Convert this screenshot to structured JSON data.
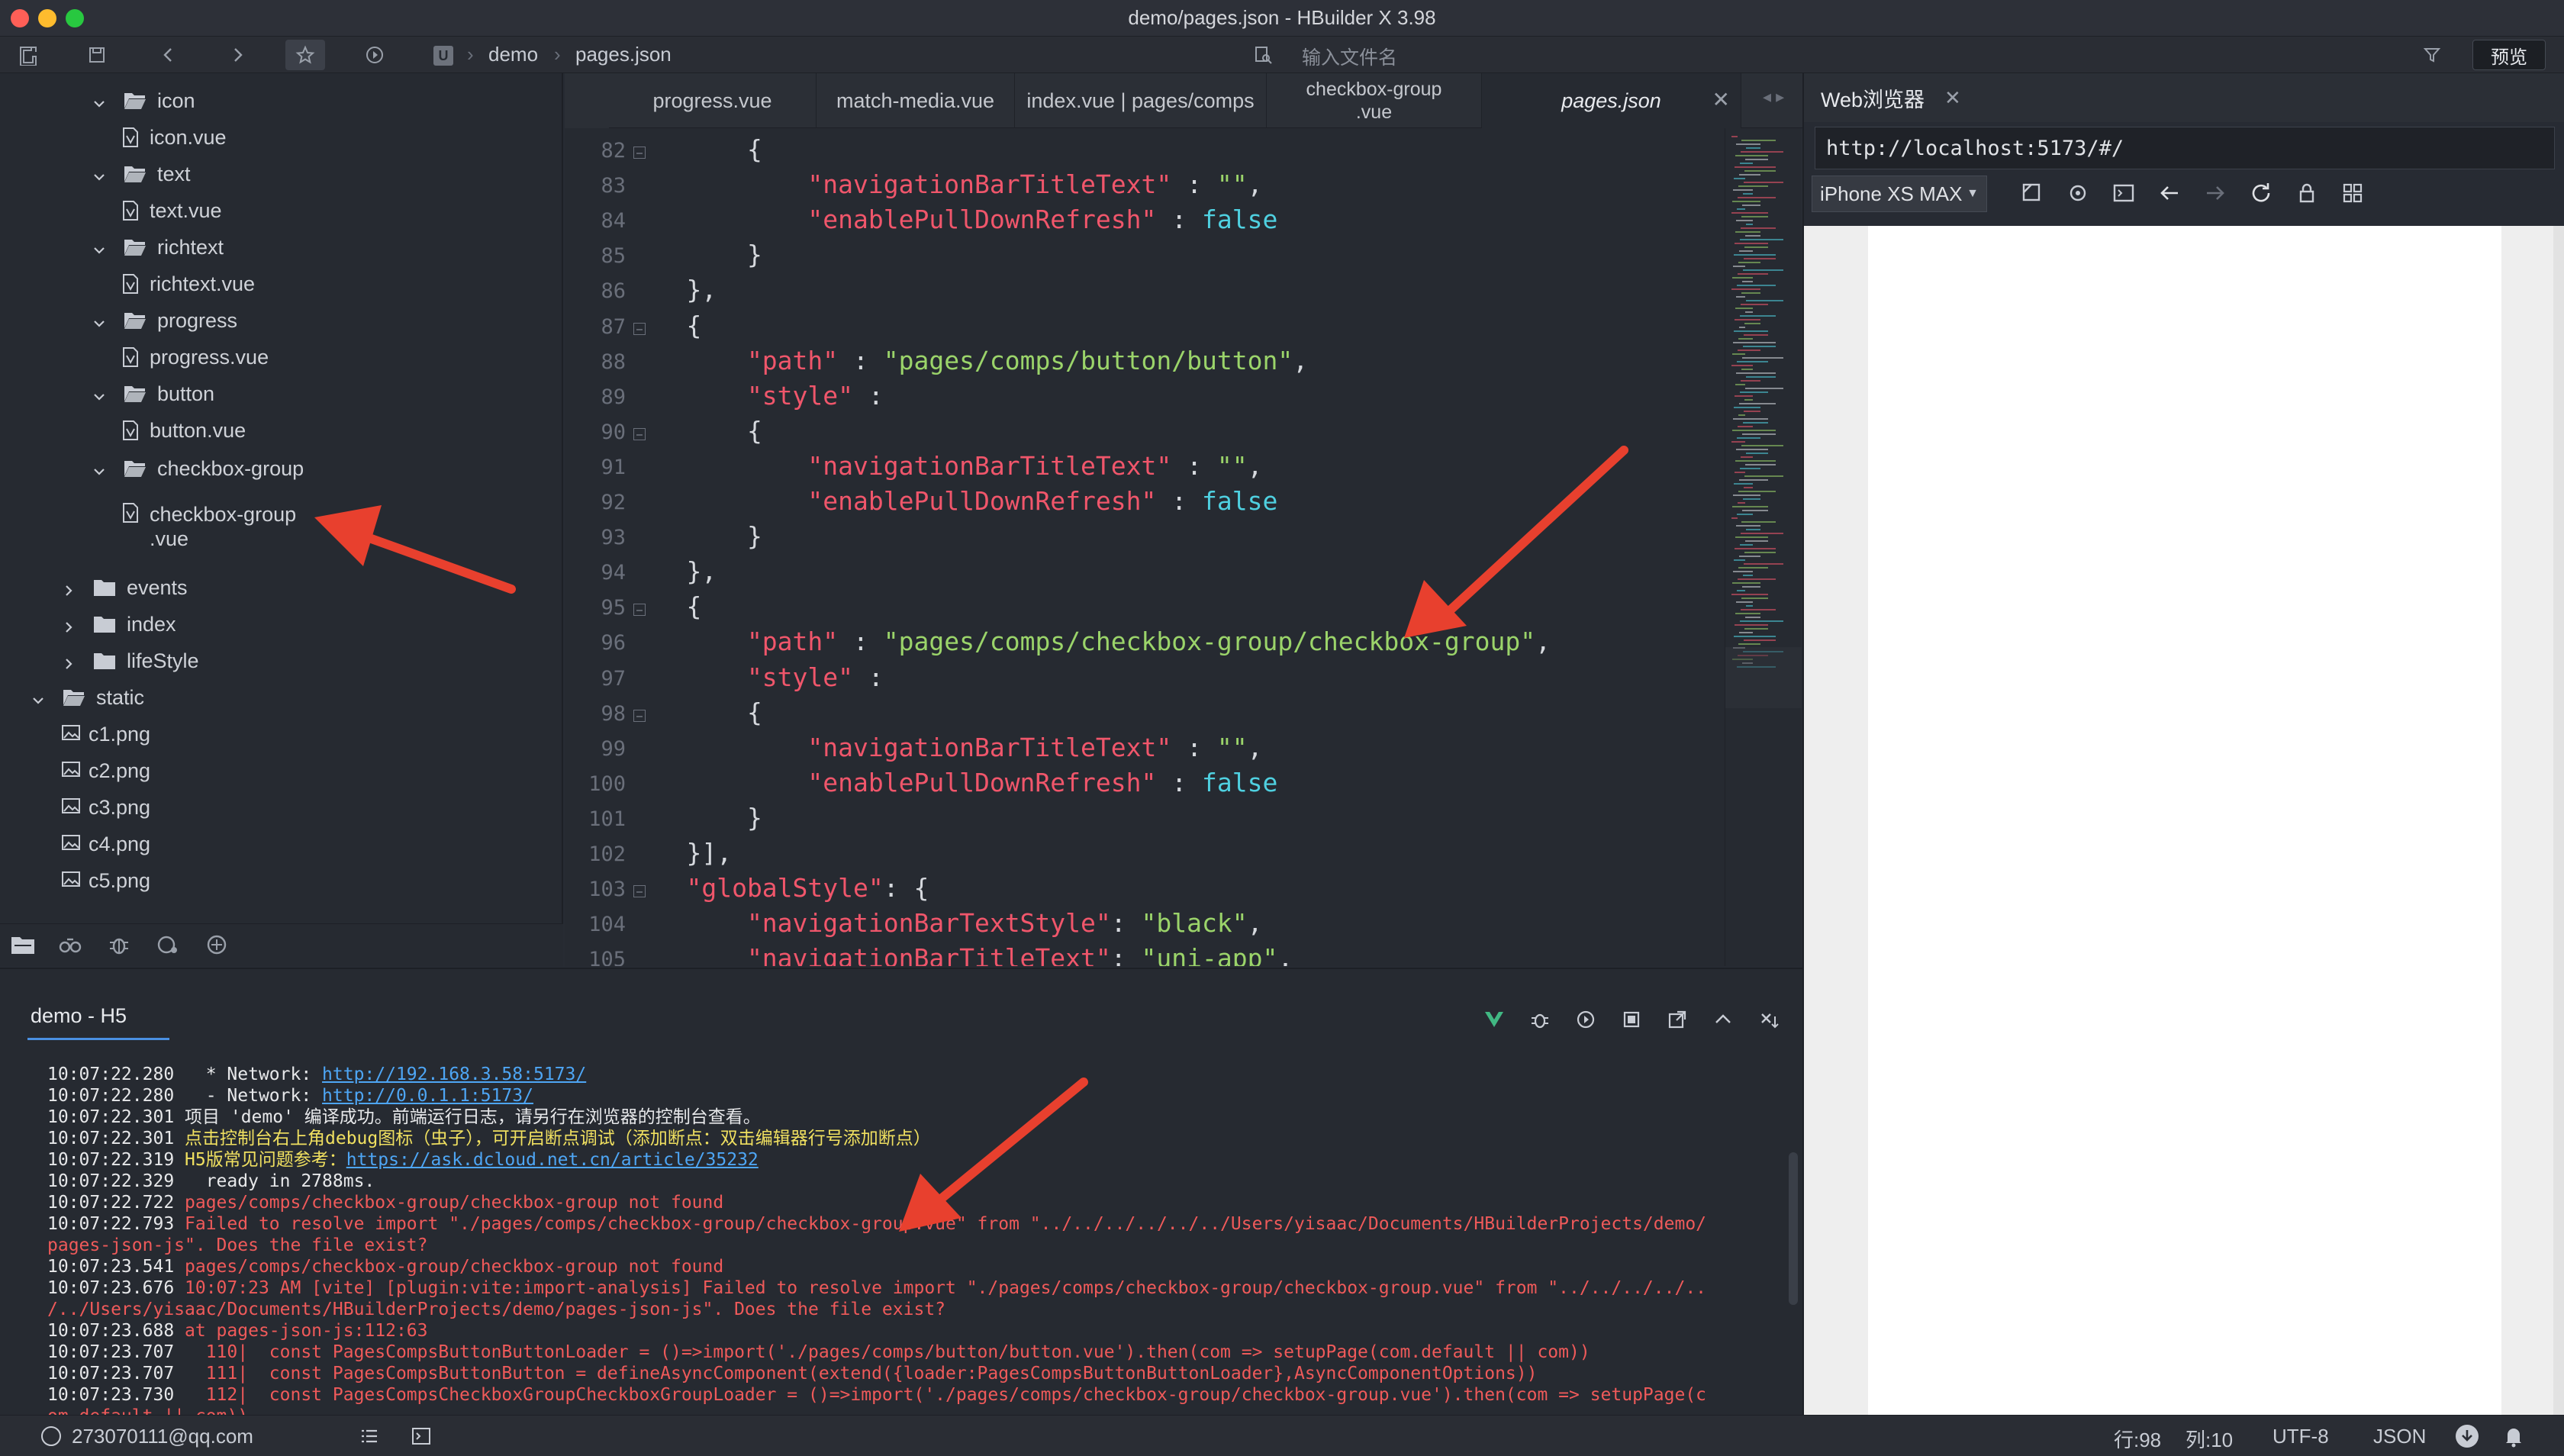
{
  "window": {
    "title": "demo/pages.json - HBuilder X 3.98"
  },
  "toolbar": {
    "breadcrumb": [
      "demo",
      "pages.json"
    ],
    "file_search_placeholder": "输入文件名",
    "preview_label": "预览"
  },
  "explorer": {
    "items": [
      {
        "label": "icon",
        "type": "folder",
        "expanded": true
      },
      {
        "label": "icon.vue",
        "type": "file"
      },
      {
        "label": "text",
        "type": "folder",
        "expanded": true
      },
      {
        "label": "text.vue",
        "type": "file"
      },
      {
        "label": "richtext",
        "type": "folder",
        "expanded": true
      },
      {
        "label": "richtext.vue",
        "type": "file"
      },
      {
        "label": "progress",
        "type": "folder",
        "expanded": true
      },
      {
        "label": "progress.vue",
        "type": "file"
      },
      {
        "label": "button",
        "type": "folder",
        "expanded": true
      },
      {
        "label": "button.vue",
        "type": "file"
      },
      {
        "label": "checkbox-group",
        "type": "folder",
        "expanded": true
      },
      {
        "label": "checkbox-group",
        "label2": ".vue",
        "type": "file"
      },
      {
        "label": "events",
        "type": "folder",
        "expanded": false
      },
      {
        "label": "index",
        "type": "folder",
        "expanded": false
      },
      {
        "label": "lifeStyle",
        "type": "folder",
        "expanded": false
      },
      {
        "label": "static",
        "type": "folder",
        "expanded": true
      },
      {
        "label": "c1.png",
        "type": "image"
      },
      {
        "label": "c2.png",
        "type": "image"
      },
      {
        "label": "c3.png",
        "type": "image"
      },
      {
        "label": "c4.png",
        "type": "image"
      },
      {
        "label": "c5.png",
        "type": "image"
      }
    ]
  },
  "tabs": [
    {
      "label": "progress.vue",
      "active": false
    },
    {
      "label": "match-media.vue",
      "active": false
    },
    {
      "label": "index.vue | pages/comps",
      "active": false
    },
    {
      "label": "checkbox-group\n.vue",
      "active": false
    },
    {
      "label": "pages.json",
      "active": true
    }
  ],
  "editor": {
    "lines": [
      {
        "n": "82",
        "fold": true,
        "parts": [
          [
            "p",
            "        {"
          ]
        ]
      },
      {
        "n": "83",
        "fold": false,
        "parts": [
          [
            "k",
            "            \"navigationBarTitleText\""
          ],
          [
            "p",
            " : "
          ],
          [
            "s",
            "\"\""
          ],
          [
            "p",
            ","
          ]
        ]
      },
      {
        "n": "84",
        "fold": false,
        "parts": [
          [
            "k",
            "            \"enablePullDownRefresh\""
          ],
          [
            "p",
            " : "
          ],
          [
            "b",
            "false"
          ]
        ]
      },
      {
        "n": "85",
        "fold": false,
        "parts": [
          [
            "p",
            "        }"
          ]
        ]
      },
      {
        "n": "86",
        "fold": false,
        "parts": [
          [
            "p",
            "    },"
          ]
        ]
      },
      {
        "n": "87",
        "fold": true,
        "parts": [
          [
            "p",
            "    {"
          ]
        ]
      },
      {
        "n": "88",
        "fold": false,
        "parts": [
          [
            "k",
            "        \"path\""
          ],
          [
            "p",
            " : "
          ],
          [
            "s",
            "\"pages/comps/button/button\""
          ],
          [
            "p",
            ","
          ]
        ]
      },
      {
        "n": "89",
        "fold": false,
        "parts": [
          [
            "k",
            "        \"style\""
          ],
          [
            "p",
            " :"
          ]
        ]
      },
      {
        "n": "90",
        "fold": true,
        "parts": [
          [
            "p",
            "        {"
          ]
        ]
      },
      {
        "n": "91",
        "fold": false,
        "parts": [
          [
            "k",
            "            \"navigationBarTitleText\""
          ],
          [
            "p",
            " : "
          ],
          [
            "s",
            "\"\""
          ],
          [
            "p",
            ","
          ]
        ]
      },
      {
        "n": "92",
        "fold": false,
        "parts": [
          [
            "k",
            "            \"enablePullDownRefresh\""
          ],
          [
            "p",
            " : "
          ],
          [
            "b",
            "false"
          ]
        ]
      },
      {
        "n": "93",
        "fold": false,
        "parts": [
          [
            "p",
            "        }"
          ]
        ]
      },
      {
        "n": "94",
        "fold": false,
        "parts": [
          [
            "p",
            "    },"
          ]
        ]
      },
      {
        "n": "95",
        "fold": true,
        "parts": [
          [
            "p",
            "    {"
          ]
        ]
      },
      {
        "n": "96",
        "fold": false,
        "parts": [
          [
            "k",
            "        \"path\""
          ],
          [
            "p",
            " : "
          ],
          [
            "s",
            "\"pages/comps/checkbox-group/checkbox-group\""
          ],
          [
            "p",
            ","
          ]
        ]
      },
      {
        "n": "97",
        "fold": false,
        "parts": [
          [
            "k",
            "        \"style\""
          ],
          [
            "p",
            " :"
          ]
        ]
      },
      {
        "n": "98",
        "fold": true,
        "parts": [
          [
            "p",
            "        {"
          ]
        ]
      },
      {
        "n": "99",
        "fold": false,
        "parts": [
          [
            "k",
            "            \"navigationBarTitleText\""
          ],
          [
            "p",
            " : "
          ],
          [
            "s",
            "\"\""
          ],
          [
            "p",
            ","
          ]
        ]
      },
      {
        "n": "100",
        "fold": false,
        "parts": [
          [
            "k",
            "            \"enablePullDownRefresh\""
          ],
          [
            "p",
            " : "
          ],
          [
            "b",
            "false"
          ]
        ]
      },
      {
        "n": "101",
        "fold": false,
        "parts": [
          [
            "p",
            "        }"
          ]
        ]
      },
      {
        "n": "102",
        "fold": false,
        "parts": [
          [
            "p",
            "    }],"
          ]
        ]
      },
      {
        "n": "103",
        "fold": true,
        "parts": [
          [
            "k",
            "    \"globalStyle\""
          ],
          [
            "p",
            ": {"
          ]
        ]
      },
      {
        "n": "104",
        "fold": false,
        "parts": [
          [
            "k",
            "        \"navigationBarTextStyle\""
          ],
          [
            "p",
            ": "
          ],
          [
            "s",
            "\"black\""
          ],
          [
            "p",
            ","
          ]
        ]
      },
      {
        "n": "105",
        "fold": false,
        "parts": [
          [
            "k",
            "        \"navigationBarTitleText\""
          ],
          [
            "p",
            ": "
          ],
          [
            "s",
            "\"uni-app\""
          ],
          [
            "p",
            ","
          ]
        ]
      }
    ]
  },
  "browser": {
    "tab_label": "Web浏览器",
    "url": "http://localhost:5173/#/",
    "device": "iPhone XS MAX"
  },
  "console": {
    "tab_label": "demo - H5",
    "lines": [
      [
        [
          "w",
          "10:07:22.280   * Network: "
        ],
        [
          "lnk",
          "http://192.168.3.58:5173/"
        ]
      ],
      [
        [
          "w",
          "10:07:22.280   - Network: "
        ],
        [
          "lnk",
          "http://0.0.1.1:5173/"
        ]
      ],
      [
        [
          "w",
          "10:07:22.301 项目 'demo' 编译成功。前端运行日志，请另行在浏览器的控制台查看。"
        ]
      ],
      [
        [
          "w",
          "10:07:22.301 "
        ],
        [
          "y",
          "点击控制台右上角debug图标（虫子），可开启断点调试（添加断点：双击编辑器行号添加断点）"
        ]
      ],
      [
        [
          "w",
          "10:07:22.319 "
        ],
        [
          "y",
          "H5版常见问题参考："
        ],
        [
          "lnk",
          "https://ask.dcloud.net.cn/article/35232"
        ]
      ],
      [
        [
          "w",
          "10:07:22.329   ready in 2788ms."
        ]
      ],
      [
        [
          "w",
          "10:07:22.722 "
        ],
        [
          "r",
          "pages/comps/checkbox-group/checkbox-group not found"
        ]
      ],
      [
        [
          "w",
          "10:07:22.793 "
        ],
        [
          "r",
          "Failed to resolve import \"./pages/comps/checkbox-group/checkbox-group.vue\" from \"../../../../../../Users/yisaac/Documents/HBuilderProjects/demo/"
        ]
      ],
      [
        [
          "r",
          "pages-json-js\". Does the file exist?"
        ]
      ],
      [
        [
          "w",
          "10:07:23.541 "
        ],
        [
          "r",
          "pages/comps/checkbox-group/checkbox-group not found"
        ]
      ],
      [
        [
          "w",
          "10:07:23.676 "
        ],
        [
          "r",
          "10:07:23 AM [vite] [plugin:vite:import-analysis] Failed to resolve import \"./pages/comps/checkbox-group/checkbox-group.vue\" from \"../../../../.."
        ]
      ],
      [
        [
          "r",
          "/../Users/yisaac/Documents/HBuilderProjects/demo/pages-json-js\". Does the file exist?"
        ]
      ],
      [
        [
          "w",
          "10:07:23.688 "
        ],
        [
          "r",
          "at pages-json-js:112:63"
        ]
      ],
      [
        [
          "w",
          "10:07:23.707 "
        ],
        [
          "r",
          "  110|  const PagesCompsButtonButtonLoader = ()=>import('./pages/comps/button/button.vue').then(com => setupPage(com.default || com))"
        ]
      ],
      [
        [
          "w",
          "10:07:23.707 "
        ],
        [
          "r",
          "  111|  const PagesCompsButtonButton = defineAsyncComponent(extend({loader:PagesCompsButtonButtonLoader},AsyncComponentOptions))"
        ]
      ],
      [
        [
          "w",
          "10:07:23.730 "
        ],
        [
          "r",
          "  112|  const PagesCompsCheckboxGroupCheckboxGroupLoader = ()=>import('./pages/comps/checkbox-group/checkbox-group.vue').then(com => setupPage(c"
        ]
      ],
      [
        [
          "r",
          "om.default || com))"
        ]
      ]
    ]
  },
  "status": {
    "account": "273070111@qq.com",
    "line": "行:98",
    "col": "列:10",
    "encoding": "UTF-8",
    "language": "JSON"
  },
  "colors": {
    "keyword": "#f0566b",
    "string": "#9bd46a",
    "bool": "#4fd0e0",
    "annotation_arrow": "#e8402e",
    "link": "#4ea6f5"
  }
}
